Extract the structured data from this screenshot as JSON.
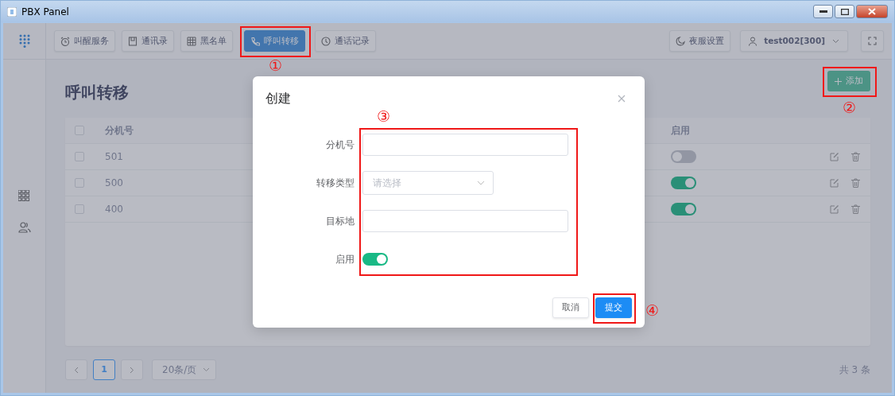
{
  "window": {
    "title": "PBX Panel"
  },
  "nav_buttons": [
    {
      "label": "叫醒服务",
      "selected": false
    },
    {
      "label": "通讯录",
      "selected": false
    },
    {
      "label": "黑名单",
      "selected": false
    },
    {
      "label": "呼叫转移",
      "selected": true
    },
    {
      "label": "通话记录",
      "selected": false
    }
  ],
  "night_button": {
    "label": "夜服设置"
  },
  "user_menu": {
    "label": "test002[300]"
  },
  "page": {
    "title": "呼叫转移",
    "add_button": "添加"
  },
  "table": {
    "columns": [
      "分机号",
      "启用"
    ],
    "header_checked": false,
    "rows": [
      {
        "extension": "501",
        "enabled": false,
        "checked": false
      },
      {
        "extension": "500",
        "enabled": true,
        "checked": false
      },
      {
        "extension": "400",
        "enabled": true,
        "checked": false
      }
    ]
  },
  "pagination": {
    "pages": [
      {
        "label": "1",
        "selected": true
      }
    ],
    "page_size": "20条/页",
    "total": "共 3 条"
  },
  "dialog": {
    "title": "创建",
    "fields": [
      {
        "label": "分机号",
        "kind": "text"
      },
      {
        "label": "转移类型",
        "kind": "select",
        "placeholder": "请选择"
      },
      {
        "label": "目标地",
        "kind": "text"
      },
      {
        "label": "启用",
        "kind": "switch",
        "on": true
      }
    ],
    "buttons": [
      {
        "label": "取消",
        "kind": "secondary"
      },
      {
        "label": "提交",
        "kind": "primary"
      }
    ]
  },
  "annotations": [
    {
      "number": "①"
    },
    {
      "number": "②"
    },
    {
      "number": "③"
    },
    {
      "number": "④"
    }
  ]
}
